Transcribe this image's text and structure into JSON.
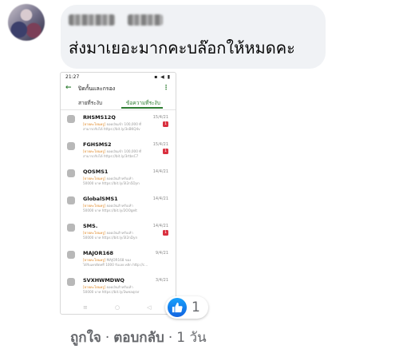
{
  "comment": {
    "text": "ส่งมาเยอะมากคะบล๊อกให้หมดคะ"
  },
  "screenshot": {
    "status_time": "21:27",
    "status_icons": "▪ ◀ ▮",
    "app_title": "ปิดกั้นและกรอง",
    "tabs": [
      {
        "label": "สายที่ระงับ"
      },
      {
        "label": "ข้อความที่ระงับ"
      }
    ],
    "messages": [
      {
        "sender": "RHSMS12Q",
        "date": "15/4/21",
        "pv1_hl": "[ยายคะโยนครู]",
        "pv1_rest": " ยอดเงินเข้า 100,000 ที่",
        "pv2": "สามารถรับได้ https://bit.ly/3sBKQ4v",
        "badge": "1"
      },
      {
        "sender": "FGHSMS2",
        "date": "15/4/21",
        "pv1_hl": "[ยายคะโยนครู]",
        "pv1_rest": " ยอดเงินเข้า 100,000 ที่",
        "pv2": "สามารถรับได้ https://bit.ly/3rtbsC7",
        "badge": "1"
      },
      {
        "sender": "QOSMS1",
        "date": "14/4/21",
        "pv1_hl": "[ยายคะโยนครู]",
        "pv1_rest": " ยอดเงินสำหรับเท้า",
        "pv2": "50000 บาท https://bit.ly/3l2n5Dyn",
        "badge": ""
      },
      {
        "sender": "GlobalSMS1",
        "date": "14/4/21",
        "pv1_hl": "[ยายคะโยนครู]",
        "pv1_rest": " ยอดเงินสำหรับเท้า",
        "pv2": "50000 บาท https://bit.ly/2OOgelt",
        "badge": ""
      },
      {
        "sender": "SMS.",
        "date": "14/4/21",
        "pv1_hl": "[ยายคะโยนครู]",
        "pv1_rest": " ยอดเงินสำหรับเท้า",
        "pv2": "50000 บาท https://bit.ly/3l2nDyn",
        "badge": "1"
      },
      {
        "sender": "MAJOR168",
        "date": "9/4/21",
        "pv1_hl": "[ยายคะโยนครู]",
        "pv1_rest": " MAJOR168 ของ",
        "pv2": "ได้รับเครดิตฟรี 1000 รับเลย คลิก http://c...",
        "badge": ""
      },
      {
        "sender": "SVXHWMDWQ",
        "date": "3/4/21",
        "pv1_hl": "[ยายคะโยนครู]",
        "pv1_rest": " ยอดเงินสำหรับเท้า",
        "pv2": "50000 บาท https://bit.ly/3weaqrar",
        "badge": ""
      }
    ],
    "nav_icons": [
      "≡",
      "○",
      "◁"
    ]
  },
  "reaction": {
    "icon": "like-icon",
    "count": "1",
    "colors": {
      "like_top": "#18a0fb",
      "like_bottom": "#1163e0"
    }
  },
  "actions": {
    "like_label": "ถูกใจ",
    "sep": "·",
    "reply_label": "ตอบกลับ",
    "time": "1 วัน"
  }
}
